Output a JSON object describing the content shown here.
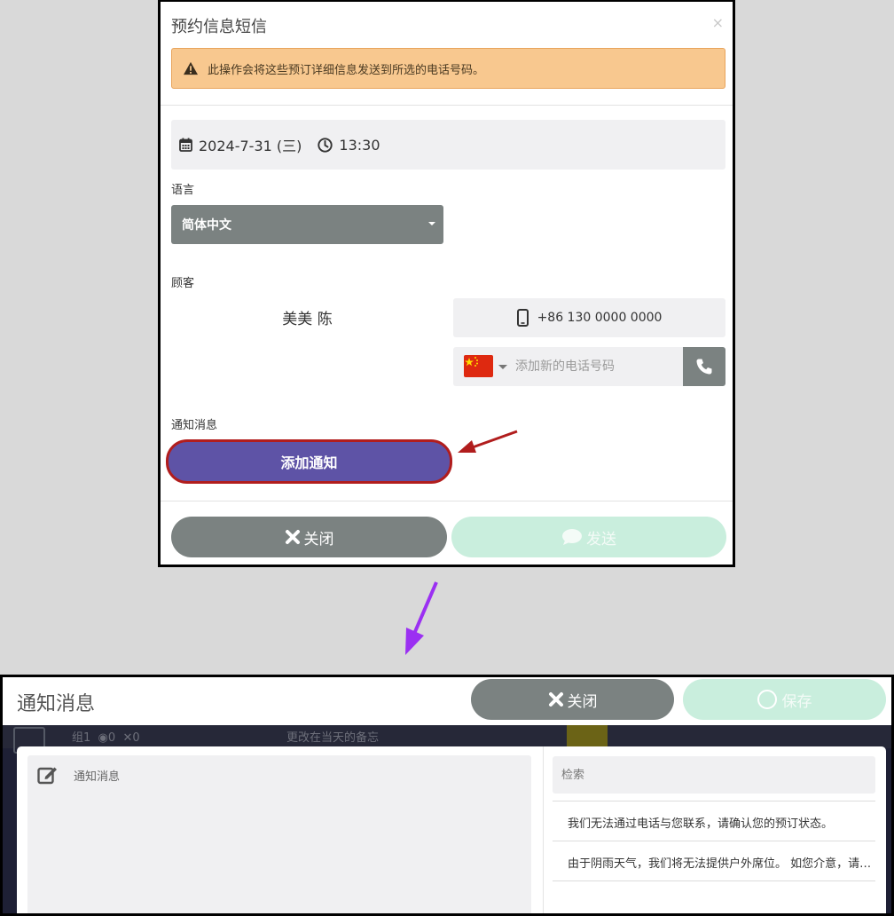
{
  "sms_modal": {
    "title": "预约信息短信",
    "close_symbol": "×",
    "warning_text": "此操作会将这些预订详细信息发送到所选的电话号码。",
    "date": "2024-7-31 (三)",
    "time": "13:30",
    "language_label": "语言",
    "language_value": "简体中文",
    "customer_label": "顾客",
    "customer_name": "美美 陈",
    "existing_phone": "+86 130 0000 0000",
    "new_phone_placeholder": "添加新的电话号码",
    "notice_label": "通知消息",
    "add_notice_button": "添加通知",
    "close_button": "关闭",
    "send_button": "发送"
  },
  "notice_panel": {
    "title": "通知消息",
    "close_button": "关闭",
    "save_button": "保存",
    "textarea_placeholder": "通知消息",
    "search_placeholder": "检索",
    "templates": [
      "我们无法通过电话与您联系，请确认您的预订状态。",
      "由于阴雨天气，我们将无法提供户外席位。 如您介意，请联系我们。"
    ]
  },
  "background_strip": {
    "group_text": "组1",
    "count_a": "0",
    "count_b": "0",
    "memo_text": "更改在当天的备忘"
  },
  "colors": {
    "gray_button": "#7b8281",
    "purple_button": "#5e53a6",
    "mint_disabled": "#c9eedd",
    "warning_bg": "#f8c88f",
    "highlight_border": "#b11d1d",
    "purple_arrow": "#9b30f2"
  }
}
